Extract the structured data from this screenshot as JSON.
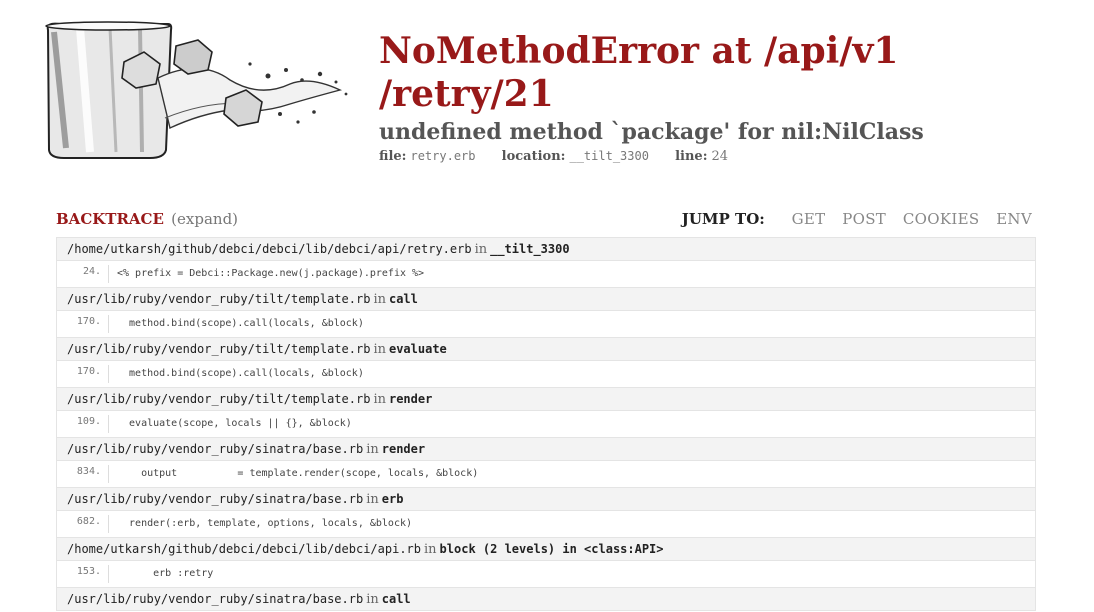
{
  "error": {
    "title": "NoMethodError at /api/v1 /retry/21",
    "message": "undefined method `package' for nil:NilClass",
    "file_label": "file:",
    "file": "retry.erb",
    "location_label": "location:",
    "location": "__tilt_3300",
    "line_label": "line:",
    "line": "24"
  },
  "backtrace": {
    "title": "BACKTRACE",
    "expand": "(expand)",
    "jump_label": "JUMP TO:",
    "jump_links": [
      "GET",
      "POST",
      "COOKIES",
      "ENV"
    ]
  },
  "frames": [
    {
      "path": "/home/utkarsh/github/debci/debci/lib/debci/api/retry.erb",
      "in": "in",
      "fn": "__tilt_3300",
      "line": "24.",
      "code": "<% prefix = Debci::Package.new(j.package).prefix %>"
    },
    {
      "path": "/usr/lib/ruby/vendor_ruby/tilt/template.rb",
      "in": "in",
      "fn": "call",
      "line": "170.",
      "code": "  method.bind(scope).call(locals, &block)"
    },
    {
      "path": "/usr/lib/ruby/vendor_ruby/tilt/template.rb",
      "in": "in",
      "fn": "evaluate",
      "line": "170.",
      "code": "  method.bind(scope).call(locals, &block)"
    },
    {
      "path": "/usr/lib/ruby/vendor_ruby/tilt/template.rb",
      "in": "in",
      "fn": "render",
      "line": "109.",
      "code": "  evaluate(scope, locals || {}, &block)"
    },
    {
      "path": "/usr/lib/ruby/vendor_ruby/sinatra/base.rb",
      "in": "in",
      "fn": "render",
      "line": "834.",
      "code": "    output          = template.render(scope, locals, &block)"
    },
    {
      "path": "/usr/lib/ruby/vendor_ruby/sinatra/base.rb",
      "in": "in",
      "fn": "erb",
      "line": "682.",
      "code": "  render(:erb, template, options, locals, &block)"
    },
    {
      "path": "/home/utkarsh/github/debci/debci/lib/debci/api.rb",
      "in": "in",
      "fn": "block (2 levels) in <class:API>",
      "line": "153.",
      "code": "      erb :retry"
    },
    {
      "path": "/usr/lib/ruby/vendor_ruby/sinatra/base.rb",
      "in": "in",
      "fn": "call",
      "line": "",
      "code": ""
    }
  ],
  "colors": {
    "accent": "#981919",
    "muted": "#888888"
  }
}
